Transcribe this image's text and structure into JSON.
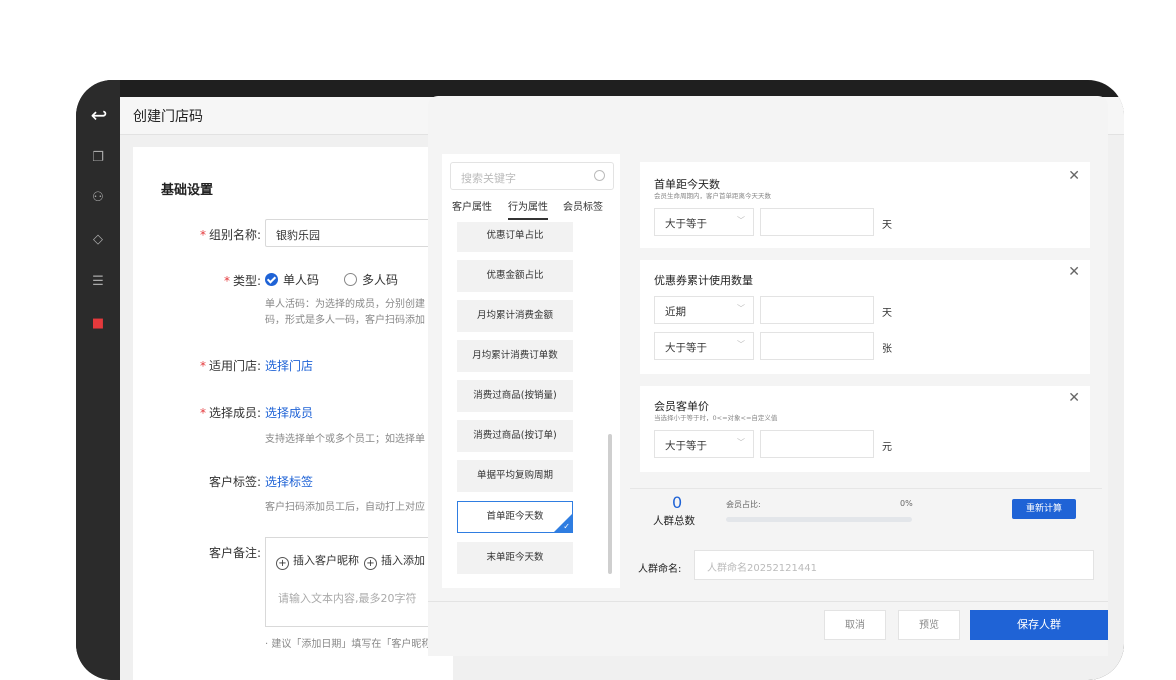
{
  "app": {
    "title": "创建门店码"
  },
  "form": {
    "section_title": "基础设置",
    "group_name_label": "组别名称:",
    "group_name_value": "银豹乐园",
    "type_label": "类型:",
    "type_option_single": "单人码",
    "type_option_multi": "多人码",
    "type_desc_line1": "单人活码：为选择的成员，分别创建",
    "type_desc_line2": "码，形式是多人一码，客户扫码添加",
    "store_label": "适用门店:",
    "store_link": "选择门店",
    "member_label": "选择成员:",
    "member_link": "选择成员",
    "member_desc": "支持选择单个或多个员工；如选择单",
    "tag_label": "客户标签:",
    "tag_link": "选择标签",
    "tag_desc": "客户扫码添加员工后，自动打上对应",
    "note_label": "客户备注:",
    "note_insert_nickname": "插入客户昵称",
    "note_insert_added": "插入添加",
    "note_placeholder": "请输入文本内容,最多20字符",
    "note_hint": "· 建议「添加日期」填写在「客户昵称"
  },
  "modal": {
    "search_placeholder": "搜索关键字",
    "tabs": [
      "客户属性",
      "行为属性",
      "会员标签"
    ],
    "attributes": [
      "优惠订单占比",
      "优惠金额占比",
      "月均累计消费金额",
      "月均累计消费订单数",
      "消费过商品(按销量)",
      "消费过商品(按订单)",
      "单据平均复购周期",
      "首单距今天数",
      "末单距今天数"
    ],
    "selected_index": 7,
    "conditions": [
      {
        "title": "首单距今天数",
        "subtitle": "会员生命周期内，客户首单距离今天天数",
        "rows": [
          {
            "operator": "大于等于",
            "unit": "天"
          }
        ]
      },
      {
        "title": "优惠券累计使用数量",
        "subtitle": "",
        "rows": [
          {
            "operator": "近期",
            "unit": "天"
          },
          {
            "operator": "大于等于",
            "unit": "张"
          }
        ]
      },
      {
        "title": "会员客单价",
        "subtitle": "当选择小于等于时，0<=对象<=自定义值",
        "rows": [
          {
            "operator": "大于等于",
            "unit": "元"
          }
        ]
      }
    ],
    "stats": {
      "count": "0",
      "count_label": "人群总数",
      "ratio_label": "会员占比:",
      "ratio_value": "0%",
      "ratio_fraction": 0,
      "recalc_button": "重新计算"
    },
    "name_label": "人群命名:",
    "name_placeholder": "人群命名20252121441",
    "buttons": {
      "cancel": "取消",
      "preview": "预览",
      "save": "保存人群"
    }
  },
  "colors": {
    "accent": "#1f63d6",
    "required": "#e4393c"
  }
}
